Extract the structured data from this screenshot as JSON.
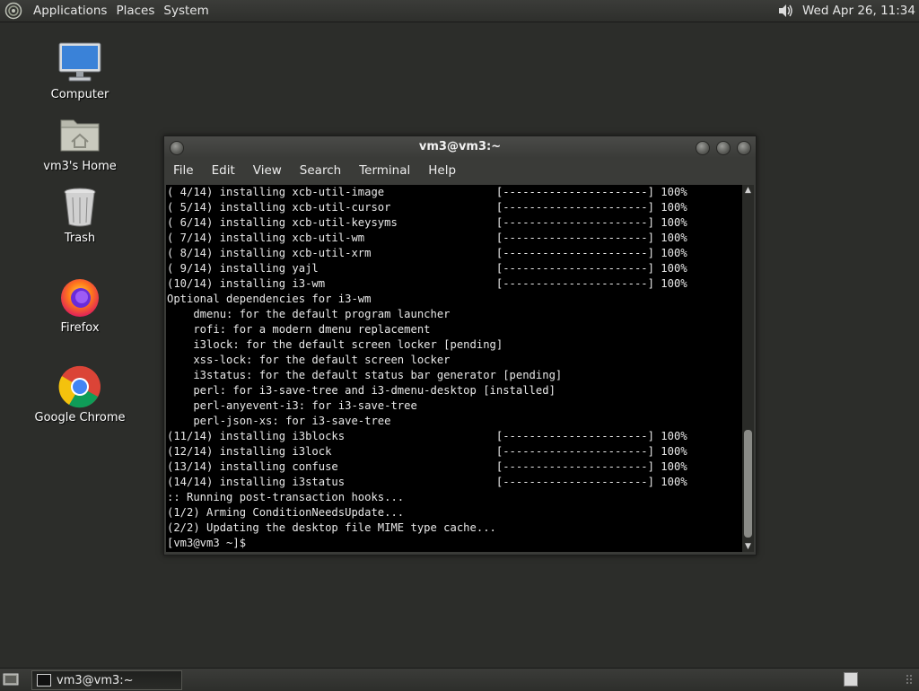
{
  "top_panel": {
    "menus": [
      "Applications",
      "Places",
      "System"
    ],
    "clock": "Wed Apr 26, 11:34",
    "volume_icon": "speaker-icon"
  },
  "desktop_icons": [
    {
      "label": "Computer",
      "icon": "computer-icon"
    },
    {
      "label": "vm3's Home",
      "icon": "home-folder-icon"
    },
    {
      "label": "Trash",
      "icon": "trash-icon"
    },
    {
      "label": "Firefox",
      "icon": "firefox-icon"
    },
    {
      "label": "Google Chrome",
      "icon": "chrome-icon"
    }
  ],
  "terminal_window": {
    "title": "vm3@vm3:~",
    "menu": [
      "File",
      "Edit",
      "View",
      "Search",
      "Terminal",
      "Help"
    ],
    "lines": [
      "( 4/14) installing xcb-util-image                 [----------------------] 100%",
      "( 5/14) installing xcb-util-cursor                [----------------------] 100%",
      "( 6/14) installing xcb-util-keysyms               [----------------------] 100%",
      "( 7/14) installing xcb-util-wm                    [----------------------] 100%",
      "( 8/14) installing xcb-util-xrm                   [----------------------] 100%",
      "( 9/14) installing yajl                           [----------------------] 100%",
      "(10/14) installing i3-wm                          [----------------------] 100%",
      "Optional dependencies for i3-wm",
      "    dmenu: for the default program launcher",
      "    rofi: for a modern dmenu replacement",
      "    i3lock: for the default screen locker [pending]",
      "    xss-lock: for the default screen locker",
      "    i3status: for the default status bar generator [pending]",
      "    perl: for i3-save-tree and i3-dmenu-desktop [installed]",
      "    perl-anyevent-i3: for i3-save-tree",
      "    perl-json-xs: for i3-save-tree",
      "(11/14) installing i3blocks                       [----------------------] 100%",
      "(12/14) installing i3lock                         [----------------------] 100%",
      "(13/14) installing confuse                        [----------------------] 100%",
      "(14/14) installing i3status                       [----------------------] 100%",
      ":: Running post-transaction hooks...",
      "(1/2) Arming ConditionNeedsUpdate...",
      "(2/2) Updating the desktop file MIME type cache...",
      "[vm3@vm3 ~]$ "
    ]
  },
  "bottom_panel": {
    "task": "vm3@vm3:~"
  },
  "colors": {
    "desktop_bg": "#2c2d2a",
    "panel_bg": "#33342f",
    "terminal_bg": "#000000",
    "terminal_fg": "#e8e8e8"
  }
}
